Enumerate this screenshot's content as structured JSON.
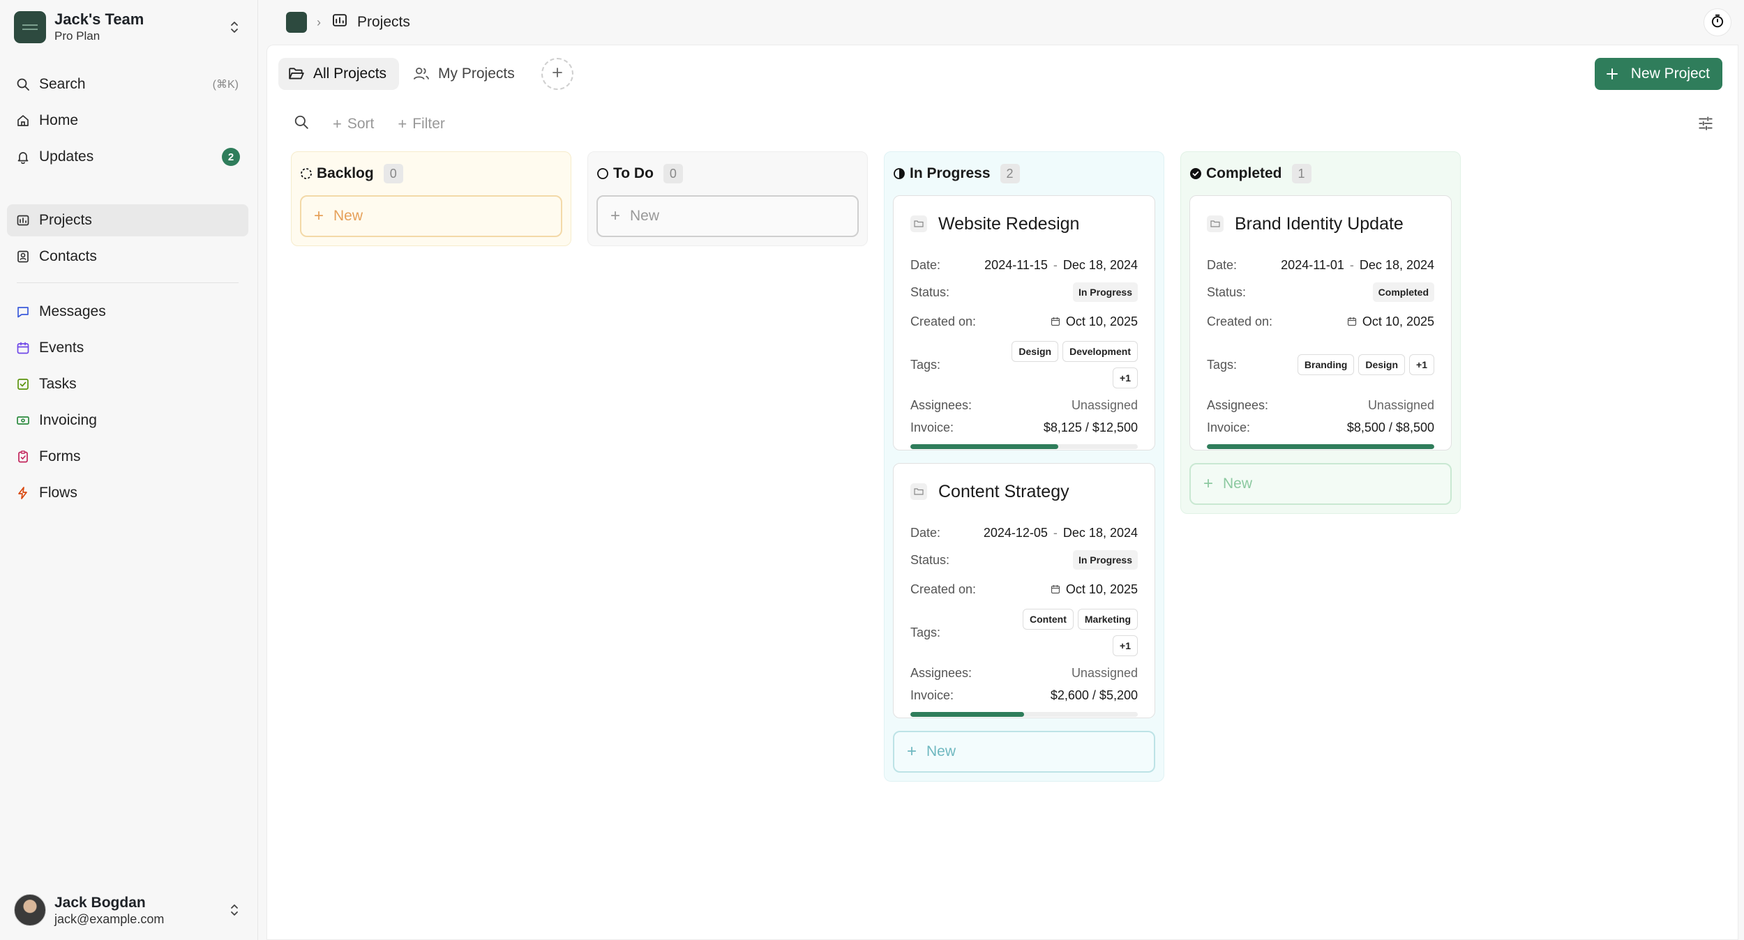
{
  "team": {
    "name": "Jack's Team",
    "plan": "Pro Plan"
  },
  "sidebar": {
    "top": [
      {
        "label": "Search",
        "shortcut": "(⌘K)"
      },
      {
        "label": "Home"
      },
      {
        "label": "Updates",
        "badge": "2"
      }
    ],
    "main": [
      {
        "label": "Projects"
      },
      {
        "label": "Contacts"
      }
    ],
    "apps": [
      {
        "label": "Messages"
      },
      {
        "label": "Events"
      },
      {
        "label": "Tasks"
      },
      {
        "label": "Invoicing"
      },
      {
        "label": "Forms"
      },
      {
        "label": "Flows"
      }
    ]
  },
  "user": {
    "name": "Jack Bogdan",
    "email": "jack@example.com"
  },
  "breadcrumb": {
    "page": "Projects"
  },
  "tabs": [
    {
      "label": "All Projects"
    },
    {
      "label": "My Projects"
    }
  ],
  "toolbar": {
    "new_project": "New Project",
    "sort": "Sort",
    "filter": "Filter"
  },
  "columns": [
    {
      "title": "Backlog",
      "count": "0",
      "new_label": "New"
    },
    {
      "title": "To Do",
      "count": "0",
      "new_label": "New"
    },
    {
      "title": "In Progress",
      "count": "2",
      "new_label": "New"
    },
    {
      "title": "Completed",
      "count": "1",
      "new_label": "New"
    }
  ],
  "field_labels": {
    "date": "Date:",
    "status": "Status:",
    "created": "Created on:",
    "tags": "Tags:",
    "assignees": "Assignees:",
    "invoice": "Invoice:"
  },
  "cards": [
    {
      "title": "Website Redesign",
      "date_start": "2024-11-15",
      "date_end": "Dec 18, 2024",
      "status": "In Progress",
      "created": "Oct 10, 2025",
      "tags": [
        "Design",
        "Development",
        "+1"
      ],
      "assignees": "Unassigned",
      "invoice": "$8,125 / $12,500",
      "invoice_progress": 0.65
    },
    {
      "title": "Content Strategy",
      "date_start": "2024-12-05",
      "date_end": "Dec 18, 2024",
      "status": "In Progress",
      "created": "Oct 10, 2025",
      "tags": [
        "Content",
        "Marketing",
        "+1"
      ],
      "assignees": "Unassigned",
      "invoice": "$2,600 / $5,200",
      "invoice_progress": 0.5
    },
    {
      "title": "Brand Identity Update",
      "date_start": "2024-11-01",
      "date_end": "Dec 18, 2024",
      "status": "Completed",
      "created": "Oct 10, 2025",
      "tags": [
        "Branding",
        "Design",
        "+1"
      ],
      "assignees": "Unassigned",
      "invoice": "$8,500 / $8,500",
      "invoice_progress": 1.0
    }
  ],
  "colors": {
    "accent": "#2f7d5b",
    "backlog_bg": "#fffbef",
    "backlog_border": "#f3d9a8",
    "todo_bg": "#f8f8f8",
    "inprogress_bg": "#f0fbfc",
    "inprogress_border": "#bde3e6",
    "completed_bg": "#f1faf3",
    "completed_border": "#c9e8d2"
  }
}
